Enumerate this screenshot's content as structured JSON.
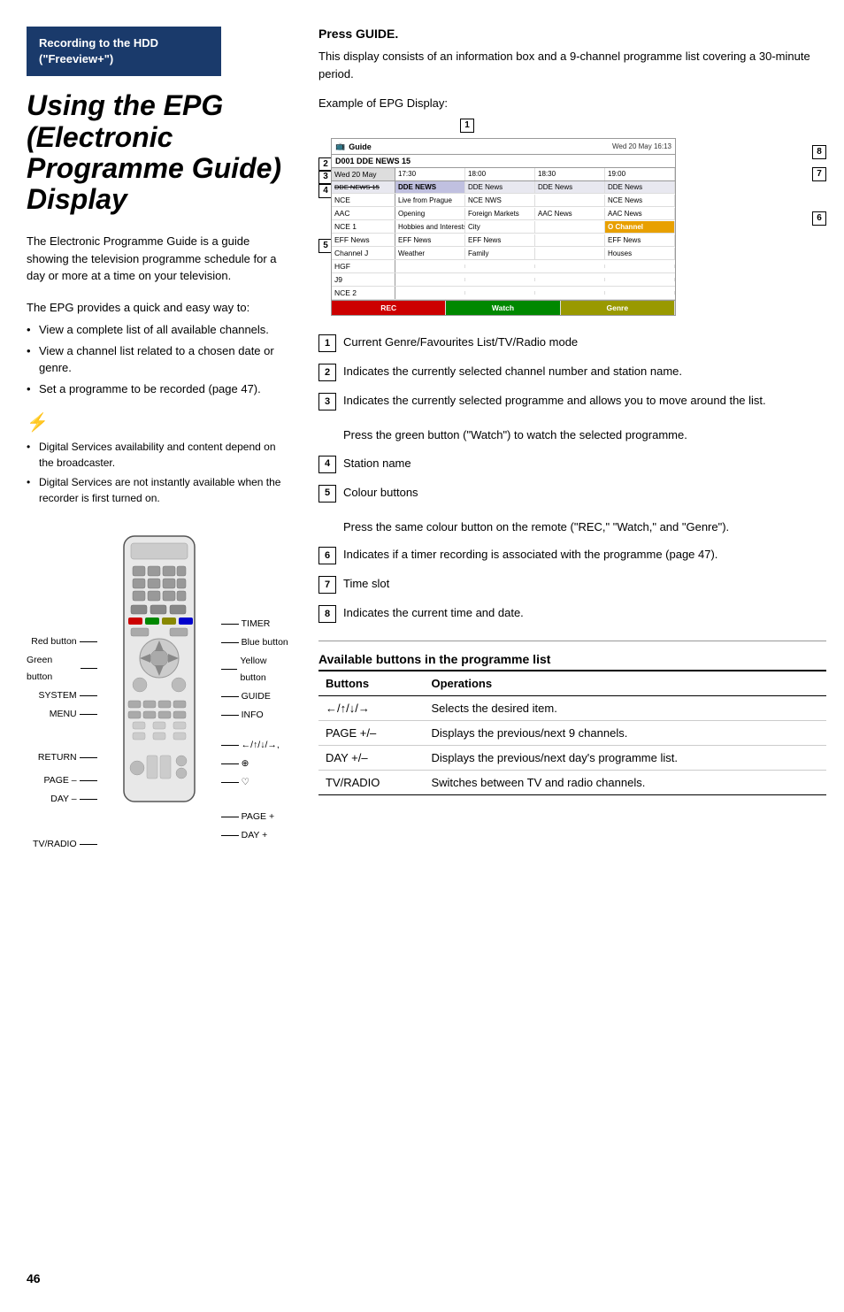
{
  "recording_box": {
    "line1": "Recording to the HDD",
    "line2": "(\"Freeview+\")"
  },
  "main_title": "Using the EPG (Electronic Programme Guide) Display",
  "description1": "The Electronic Programme Guide is a guide showing the television programme schedule for a day or more at a time on your television.",
  "provides_intro": "The EPG provides a quick and easy way to:",
  "provides_items": [
    "View a complete list of all available channels.",
    "View a channel list related to a chosen date or genre.",
    "Set a programme to be recorded (page 47)."
  ],
  "note_items": [
    "Digital Services availability and content depend on the broadcaster.",
    "Digital Services are not instantly available when the recorder is first turned on."
  ],
  "remote_labels_left": [
    "Red button",
    "Green button",
    "SYSTEM",
    "MENU",
    "",
    "RETURN",
    "PAGE –",
    "DAY –",
    "",
    "TV/RADIO"
  ],
  "remote_labels_right": [
    "TIMER",
    "Blue button",
    "Yellow button",
    "GUIDE",
    "INFO",
    "←/↑/↓/→,",
    "⊕",
    "♡",
    "",
    "PAGE +",
    "DAY +"
  ],
  "press_guide_title": "Press GUIDE.",
  "intro_text": "This display consists of an information box and a 9-channel programme list covering a 30-minute period.",
  "example_label": "Example of EPG Display:",
  "epg": {
    "guide_label": "Guide",
    "date": "Wed 20 May 16:13",
    "channel_row": "D001 DDE NEWS 15",
    "time_slots": [
      "17:30",
      "18:00",
      "18:30",
      "19:00"
    ],
    "channels": [
      {
        "name": "DDE NEWS 15",
        "programmes": [
          "DDE NEWS",
          "DDE NEWS",
          "DDE News",
          "DDE News"
        ]
      },
      {
        "name": "NCE",
        "programmes": [
          "Live from Prague",
          "NCE NWS",
          "",
          "NCE News"
        ]
      },
      {
        "name": "AAC",
        "programmes": [
          "Opening",
          "Foreign Markets",
          "AAC News",
          "AAC News"
        ]
      },
      {
        "name": "NCE 1",
        "programmes": [
          "Hobbies and Interests",
          "City",
          "",
          "O Channel"
        ]
      },
      {
        "name": "EFF News",
        "programmes": [
          "EFF News",
          "EFF News",
          "",
          "EFF News"
        ]
      },
      {
        "name": "Channel J",
        "programmes": [
          "Weather",
          "Family",
          "",
          "Houses"
        ]
      },
      {
        "name": "HGF",
        "programmes": [
          "",
          "",
          "",
          ""
        ]
      },
      {
        "name": "J9",
        "programmes": [
          "",
          "",
          "",
          ""
        ]
      },
      {
        "name": "NCE 2",
        "programmes": [
          "",
          "",
          "",
          ""
        ]
      }
    ],
    "footer_buttons": [
      "REC",
      "Watch",
      "Genre"
    ]
  },
  "numbered_items": [
    {
      "num": "1",
      "text": "Current Genre/Favourites List/TV/Radio mode"
    },
    {
      "num": "2",
      "text": "Indicates the currently selected channel number and station name."
    },
    {
      "num": "3",
      "text": "Indicates the currently selected programme and allows you to move around the list.\nPress the green button (“Watch”) to watch the selected programme."
    },
    {
      "num": "4",
      "text": "Station name"
    },
    {
      "num": "5",
      "text": "Colour buttons\nPress the same colour button on the remote (“REC,” “Watch,” and “Genre”)."
    },
    {
      "num": "6",
      "text": "Indicates if a timer recording is associated with the programme (page 47)."
    },
    {
      "num": "7",
      "text": "Time slot"
    },
    {
      "num": "8",
      "text": "Indicates the current time and date."
    }
  ],
  "available_title": "Available buttons in the programme list",
  "table_headers": [
    "Buttons",
    "Operations"
  ],
  "table_rows": [
    {
      "button": "←/↑/↓/→",
      "operation": "Selects the desired item."
    },
    {
      "button": "PAGE +/–",
      "operation": "Displays the previous/next 9 channels."
    },
    {
      "button": "DAY +/–",
      "operation": "Displays the previous/next day's programme list."
    },
    {
      "button": "TV/RADIO",
      "operation": "Switches between TV and radio channels."
    }
  ],
  "page_number": "46"
}
